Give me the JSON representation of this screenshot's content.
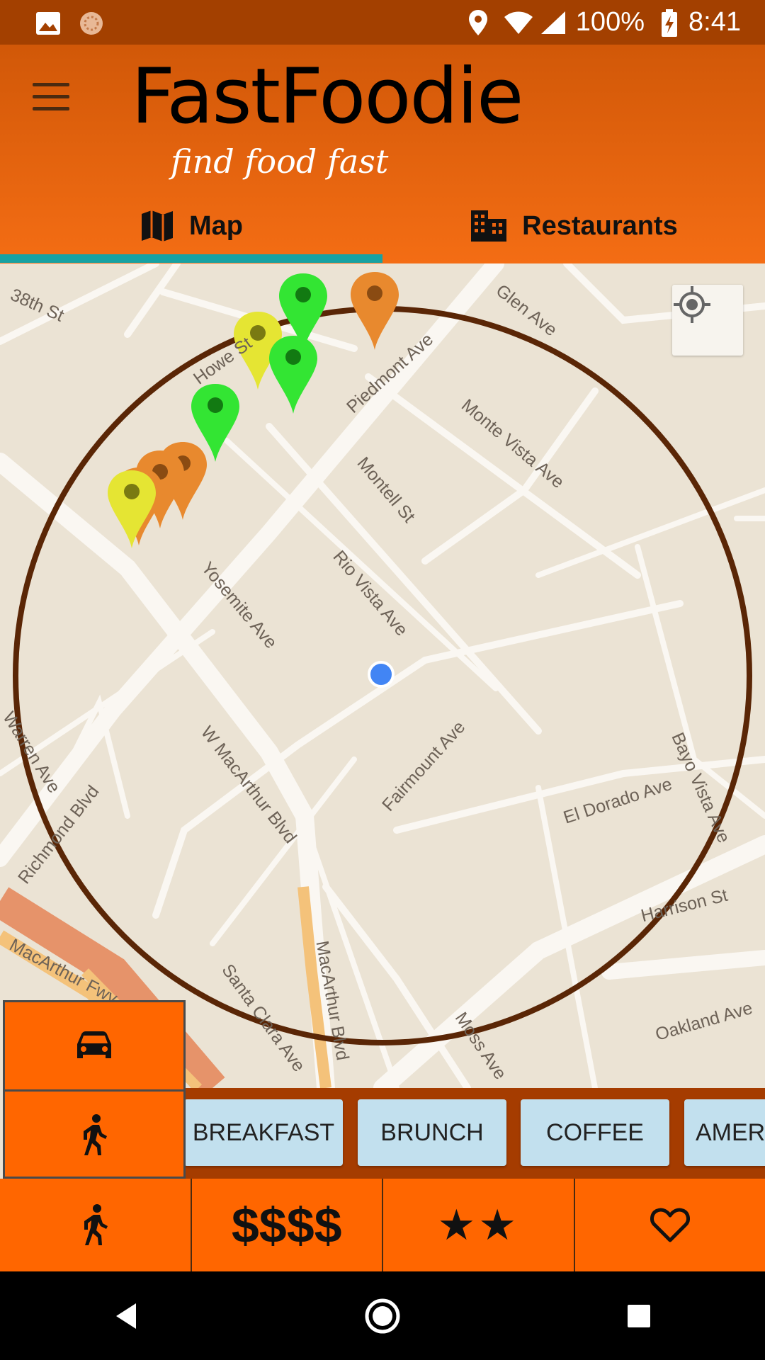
{
  "status_bar": {
    "battery": "100%",
    "time": "8:41"
  },
  "app": {
    "name": "FastFoodie",
    "tagline": "find food fast"
  },
  "tabs": [
    {
      "label": "Map",
      "icon": "map-icon",
      "selected": true
    },
    {
      "label": "Restaurants",
      "icon": "building-icon",
      "selected": false
    }
  ],
  "map": {
    "streets": [
      "38th St",
      "Howe St",
      "Piedmont Ave",
      "Glen Ave",
      "Monte Vista Ave",
      "Montell St",
      "Rio Vista Ave",
      "Yosemite Ave",
      "Warren Ave",
      "Richmond Blvd",
      "W MacArthur Blvd",
      "Fairmount Ave",
      "El Dorado Ave",
      "Bayo Vista Ave",
      "Harrison St",
      "MacArthur Fwy",
      "Santa Clara Ave",
      "MacArthur Blvd",
      "Moss Ave",
      "Oakland Ave"
    ],
    "marker_colors": {
      "green": "#33e533",
      "yellow": "#e5e533",
      "orange": "#e8892e"
    },
    "user_location_color": "#4285f4",
    "radius_circle_color": "#5a2606"
  },
  "transport_modes": [
    {
      "icon": "car-icon"
    },
    {
      "icon": "walk-icon"
    }
  ],
  "categories": [
    "BREAKFAST",
    "BRUNCH",
    "COFFEE",
    "AMER"
  ],
  "filters": {
    "mode_icon": "walk-icon",
    "price": "$$$$",
    "rating": "★★",
    "favorite_icon": "heart-icon"
  },
  "colors": {
    "accent": "#ff6600",
    "tab_indicator": "#17a2a3",
    "chip_bg": "#c2e0ee"
  }
}
